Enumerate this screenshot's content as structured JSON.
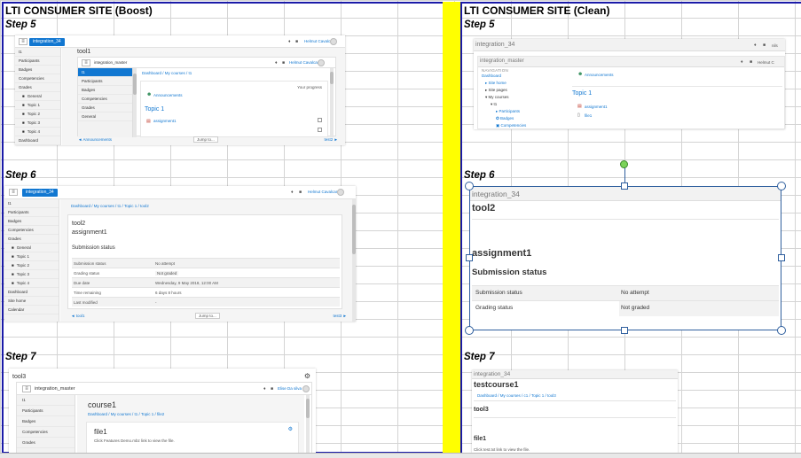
{
  "columns": {
    "left_title": "LTI CONSUMER SITE (Boost)",
    "right_title": "LTI CONSUMER SITE (Clean)"
  },
  "steps": {
    "s5": "Step 5",
    "s6": "Step 6",
    "s7": "Step 7"
  },
  "boost5": {
    "course_button": "integration_34",
    "user": "Helmut Cavalcanti",
    "tool_title": "tool1",
    "inner_site": "integration_master",
    "inner_user": "Helmut Cavalcanti",
    "outer_side_items": [
      "t1",
      "Participants",
      "Badges",
      "Competencies",
      "Grades",
      "General",
      "Topic 1",
      "Topic 2",
      "Topic 3",
      "Topic 4",
      "Dashboard"
    ],
    "inner_side_items": [
      "t1",
      "Participants",
      "Badges",
      "Competencies",
      "Grades",
      "General"
    ],
    "crumb": "Dashboard / My courses / t1",
    "progress": "Your progress",
    "announcements": "Announcements",
    "topic": "Topic 1",
    "activity1": "assignment1",
    "prev": "◄ Announcements",
    "jump": "Jump to...",
    "next": "test2 ►"
  },
  "boost6": {
    "course_button": "integration_34",
    "user": "Helmut Cavalcanti",
    "side_items": [
      "t1",
      "Participants",
      "Badges",
      "Competencies",
      "Grades",
      "General",
      "Topic 1",
      "Topic 2",
      "Topic 3",
      "Topic 4",
      "Dashboard",
      "Site home",
      "Calendar"
    ],
    "crumb": "Dashboard / My courses / t1 / Topic 1 / tool2",
    "tool_title": "tool2",
    "assignment": "assignment1",
    "status_heading": "Submission status",
    "rows": [
      {
        "label": "Submission status",
        "value": "No attempt"
      },
      {
        "label": "Grading status",
        "value": "Not graded"
      },
      {
        "label": "Due date",
        "value": "Wednesday, 9 May 2018, 12:00 AM"
      },
      {
        "label": "Time remaining",
        "value": "6 days 8 hours"
      },
      {
        "label": "Last modified",
        "value": "-"
      }
    ],
    "prev": "◄ tool1",
    "jump": "Jump to...",
    "next": "test3 ►"
  },
  "boost7": {
    "tool_title": "tool3",
    "site": "integration_master",
    "user": "Elise Da silva",
    "side_items": [
      "t1",
      "Participants",
      "Badges",
      "Competencies",
      "Grades"
    ],
    "course_title": "course1",
    "crumb": "Dashboard / My courses / t1 / Topic 1 / file2",
    "file_title": "file1",
    "file_text": "Click Features Demo.mbz link to view the file."
  },
  "clean5": {
    "header": "integration_34",
    "header_right": "nils",
    "inner_header": "integration_master",
    "inner_user": "Helmut C",
    "nav_title": "NAVIGATION",
    "nav_items": [
      "Dashboard",
      "Site home",
      "Site pages",
      "My courses",
      "t1",
      "Participants",
      "Badges",
      "Competencies",
      "Grades"
    ],
    "announcements": "Announcements",
    "topic": "Topic 1",
    "activity1": "assignment1",
    "activity2": "file1"
  },
  "clean6": {
    "header": "integration_34",
    "tool_title": "tool2",
    "assignment": "assignment1",
    "status_heading": "Submission status",
    "rows": [
      {
        "label": "Submission status",
        "value": "No attempt"
      },
      {
        "label": "Grading status",
        "value": "Not graded"
      }
    ]
  },
  "clean7": {
    "header": "integration_34",
    "course_title": "testcourse1",
    "crumb": "Dashboard / My courses / c1 / Topic 1 / tool3",
    "tool_title": "tool3",
    "file_title": "file1",
    "file_text": "Click test.txt link to view the file."
  },
  "colors": {
    "frame": "#1a1aa8",
    "divider": "#ffff00",
    "boost_blue": "#1177d1",
    "handle_green": "#7bd35a"
  }
}
